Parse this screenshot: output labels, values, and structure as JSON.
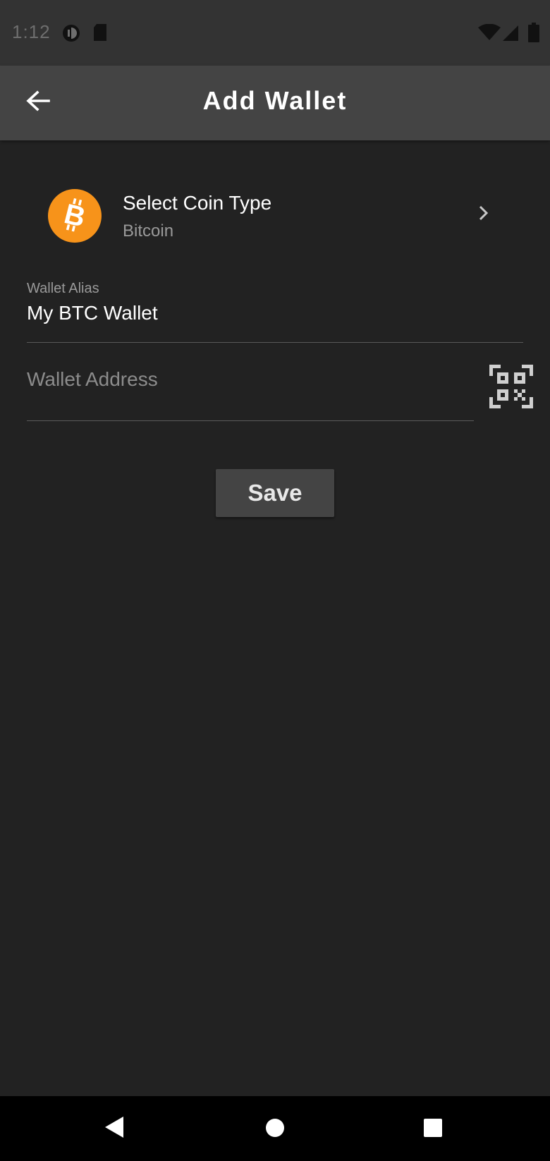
{
  "status_bar": {
    "time": "1:12",
    "icons": [
      "notification-circle-icon",
      "sd-card-icon",
      "wifi-icon",
      "cell-signal-icon",
      "battery-icon"
    ]
  },
  "app_bar": {
    "title": "Add Wallet",
    "back_icon": "arrow-left-icon"
  },
  "coin_selector": {
    "title": "Select Coin Type",
    "selected": "Bitcoin",
    "logo_icon": "bitcoin-icon",
    "logo_color": "#f7931a",
    "chevron_icon": "chevron-right-icon"
  },
  "alias_field": {
    "label": "Wallet Alias",
    "value": "My BTC Wallet"
  },
  "address_field": {
    "placeholder": "Wallet Address",
    "value": "",
    "scan_icon": "qr-code-scan-icon"
  },
  "save_button": {
    "label": "Save"
  },
  "nav_bar": {
    "icons": [
      "back-triangle-icon",
      "home-circle-icon",
      "recents-square-icon"
    ]
  },
  "colors": {
    "background": "#222222",
    "status_bar": "#333333",
    "app_bar": "#444444",
    "accent_bitcoin": "#f7931a"
  }
}
